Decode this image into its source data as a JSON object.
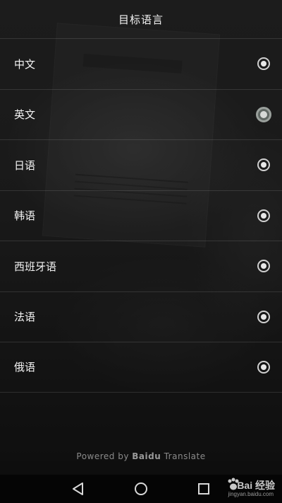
{
  "header": {
    "title": "目标语言"
  },
  "languages": [
    {
      "label": "中文",
      "selected": false
    },
    {
      "label": "英文",
      "selected": true
    },
    {
      "label": "日语",
      "selected": false
    },
    {
      "label": "韩语",
      "selected": false
    },
    {
      "label": "西班牙语",
      "selected": false
    },
    {
      "label": "法语",
      "selected": false
    },
    {
      "label": "俄语",
      "selected": false
    }
  ],
  "footer": {
    "powered_prefix": "Powered by",
    "powered_brand": "Baidu",
    "powered_suffix": "Translate"
  },
  "navbar": {
    "back_icon": "back-triangle-icon",
    "home_icon": "home-circle-icon",
    "recent_icon": "recent-square-icon"
  },
  "watermark": {
    "main": "Bai 经验",
    "sub": "jingyan.baidu.com"
  },
  "colors": {
    "selected_radio": "#5f6763",
    "text": "#f4f4f4"
  }
}
